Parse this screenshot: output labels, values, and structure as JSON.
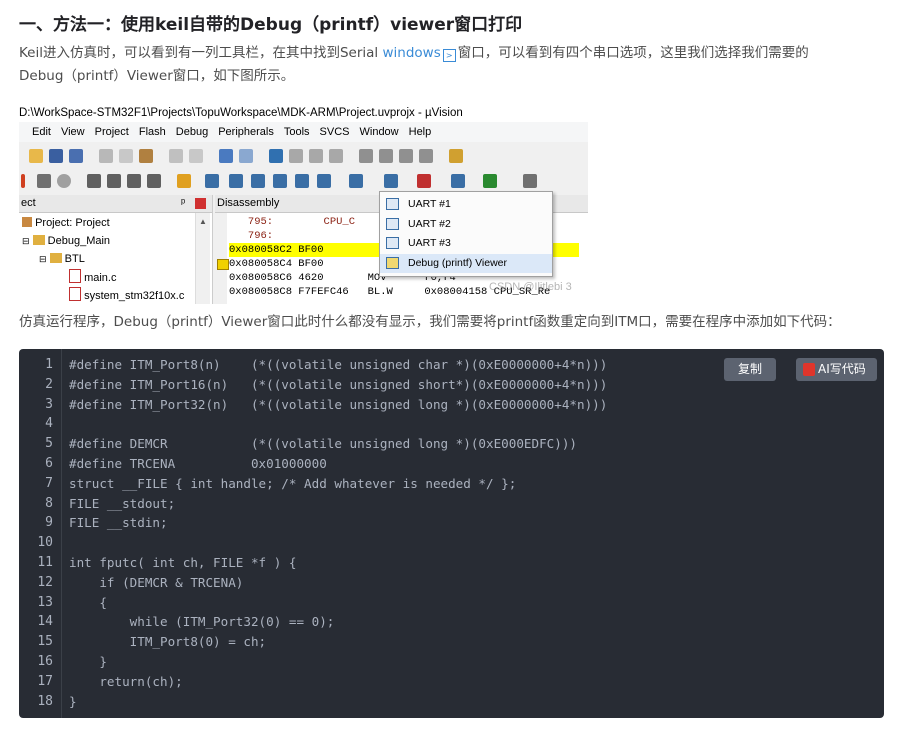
{
  "article": {
    "heading": "一、方法一：使用keil自带的Debug（printf）viewer窗口打印",
    "para1_a": "Keil进入仿真时，可以看到有一列工具栏，在其中找到Serial ",
    "para1_link": "windows",
    "para1_b": "窗口，可以看到有四个串口选项，这里我们选择我们需要的",
    "para1_line2": "Debug（printf）Viewer窗口，如下图所示。",
    "para2": "仿真运行程序，Debug（printf）Viewer窗口此时什么都没有显示，我们需要将printf函数重定向到ITM口，需要在程序中添加如下代码："
  },
  "screenshot": {
    "title": "D:\\WorkSpace-STM32F1\\Projects\\TopuWorkspace\\MDK-ARM\\Project.uvprojx - µVision",
    "menu": [
      "Edit",
      "View",
      "Project",
      "Flash",
      "Debug",
      "Peripherals",
      "Tools",
      "SVCS",
      "Window",
      "Help"
    ],
    "project_panel": {
      "header": "ect",
      "items": [
        "Project: Project",
        "Debug_Main",
        "BTL",
        "main.c",
        "system_stm32f10x.c"
      ]
    },
    "disassembly": {
      "header": "Disassembly",
      "lines": [
        "   795:        CPU_C",
        "   796:",
        "0x080058C2 BF00",
        "0x080058C4 BF00",
        "0x080058C6 4620       MOV      r0,r4",
        "0x080058C8 F7FEFC46   BL.W     0x08004158 CPU_SR_Re"
      ]
    },
    "serial_menu": [
      "UART #1",
      "UART #2",
      "UART #3",
      "Debug (printf) Viewer"
    ],
    "watermark": "CSDN @Ilitlebi 3"
  },
  "code_block": {
    "copy_label": "复制",
    "ai_label": "AI写代码",
    "line_numbers": [
      "1",
      "2",
      "3",
      "4",
      "5",
      "6",
      "7",
      "8",
      "9",
      "10",
      "11",
      "12",
      "13",
      "14",
      "15",
      "16",
      "17",
      "18"
    ],
    "lines": [
      "#define ITM_Port8(n)    (*((volatile unsigned char *)(0xE0000000+4*n)))",
      "#define ITM_Port16(n)   (*((volatile unsigned short*)(0xE0000000+4*n)))",
      "#define ITM_Port32(n)   (*((volatile unsigned long *)(0xE0000000+4*n)))",
      "",
      "#define DEMCR           (*((volatile unsigned long *)(0xE000EDFC)))",
      "#define TRCENA          0x01000000",
      "struct __FILE { int handle; /* Add whatever is needed */ };",
      "FILE __stdout;",
      "FILE __stdin;",
      "",
      "int fputc( int ch, FILE *f ) {",
      "    if (DEMCR & TRCENA)",
      "    {",
      "        while (ITM_Port32(0) == 0);",
      "        ITM_Port8(0) = ch;",
      "    }",
      "    return(ch);",
      "}"
    ]
  },
  "colors": {
    "code_bg": "#282c34",
    "code_text": "#abb2bf",
    "highlight_line": "#ffff00",
    "link": "#3a8bd6"
  }
}
